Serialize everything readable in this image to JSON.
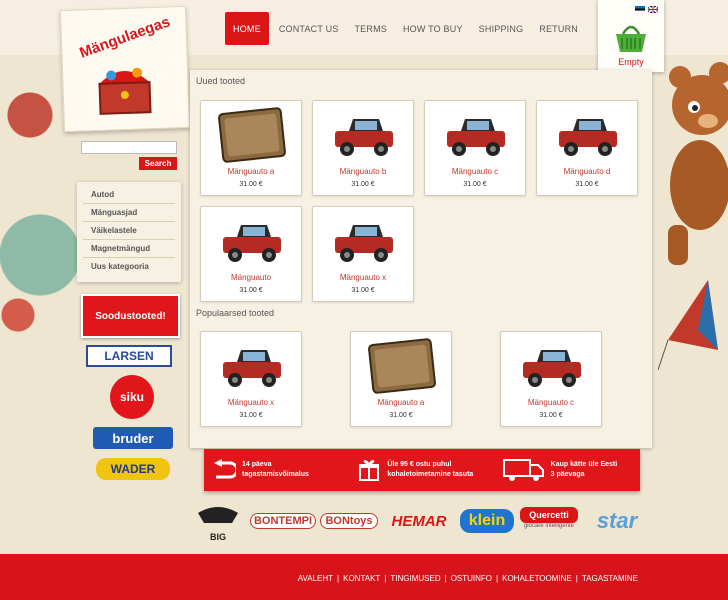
{
  "nav": {
    "items": [
      {
        "label": "HOME",
        "active": true
      },
      {
        "label": "CONTACT US"
      },
      {
        "label": "TERMS"
      },
      {
        "label": "HOW TO BUY"
      },
      {
        "label": "SHIPPING"
      },
      {
        "label": "RETURN"
      }
    ]
  },
  "logo": {
    "text": "Mängulaegas"
  },
  "cart": {
    "status": "Empty",
    "icon": "basket-icon",
    "languages": [
      "et",
      "en"
    ]
  },
  "search": {
    "placeholder": "",
    "button_label": "Search"
  },
  "categories": [
    {
      "label": "Autod"
    },
    {
      "label": "Mänguasjad"
    },
    {
      "label": "Väikelastele"
    },
    {
      "label": "Magnetmängud"
    },
    {
      "label": "Uus kategooria"
    }
  ],
  "sidebar_brands": {
    "sale": "Soodustooted!",
    "larsen": "LARSEN",
    "siku": "siku",
    "bruder": "bruder",
    "wader": "WADER"
  },
  "new_products": {
    "title": "Uued tooted",
    "items": [
      {
        "name": "Mänguauto a",
        "price": "31.00 €",
        "image": "jeans-sign"
      },
      {
        "name": "Mänguauto b",
        "price": "31.00 €",
        "image": "red-jeep"
      },
      {
        "name": "Mänguauto c",
        "price": "31.00 €",
        "image": "red-jeep"
      },
      {
        "name": "Mänguauto d",
        "price": "31.00 €",
        "image": "red-jeep"
      },
      {
        "name": "Mänguauto",
        "price": "31.00 €",
        "image": "red-jeep"
      },
      {
        "name": "Mänguauto x",
        "price": "31.00 €",
        "image": "red-jeep"
      }
    ]
  },
  "popular_products": {
    "title": "Populaarsed tooted",
    "items": [
      {
        "name": "Mänguauto x",
        "price": "31.00 €",
        "image": "red-jeep"
      },
      {
        "name": "Mänguauto a",
        "price": "31.00 €",
        "image": "jeans-sign"
      },
      {
        "name": "Mänguauto c",
        "price": "31.00 €",
        "image": "red-jeep"
      }
    ]
  },
  "benefits": [
    {
      "line1": "14 päeva",
      "line2": "tagastamisvõimalus",
      "icon": "return-arrow-icon"
    },
    {
      "line1": "Üle 95 € ostu puhul",
      "line2": "kohaletoimetamine tasuta",
      "icon": "gift-icon"
    },
    {
      "line1": "Kaup kätte üle Eesti",
      "line2": "3 päevaga",
      "icon": "truck-icon"
    }
  ],
  "brands": [
    "BIG",
    "BONTEMPI",
    "BONtoys",
    "HEMAR",
    "klein",
    "Quercetti",
    "giocare intelligente",
    "star"
  ],
  "footer": {
    "links": [
      "AVALEHT",
      "KONTAKT",
      "TINGIMUSED",
      "OSTUINFO",
      "KOHALETOOMINE",
      "TAGASTAMINE"
    ]
  },
  "colors": {
    "accent": "#d91616",
    "background": "#efe6d2",
    "panel": "#f7f1e3"
  }
}
